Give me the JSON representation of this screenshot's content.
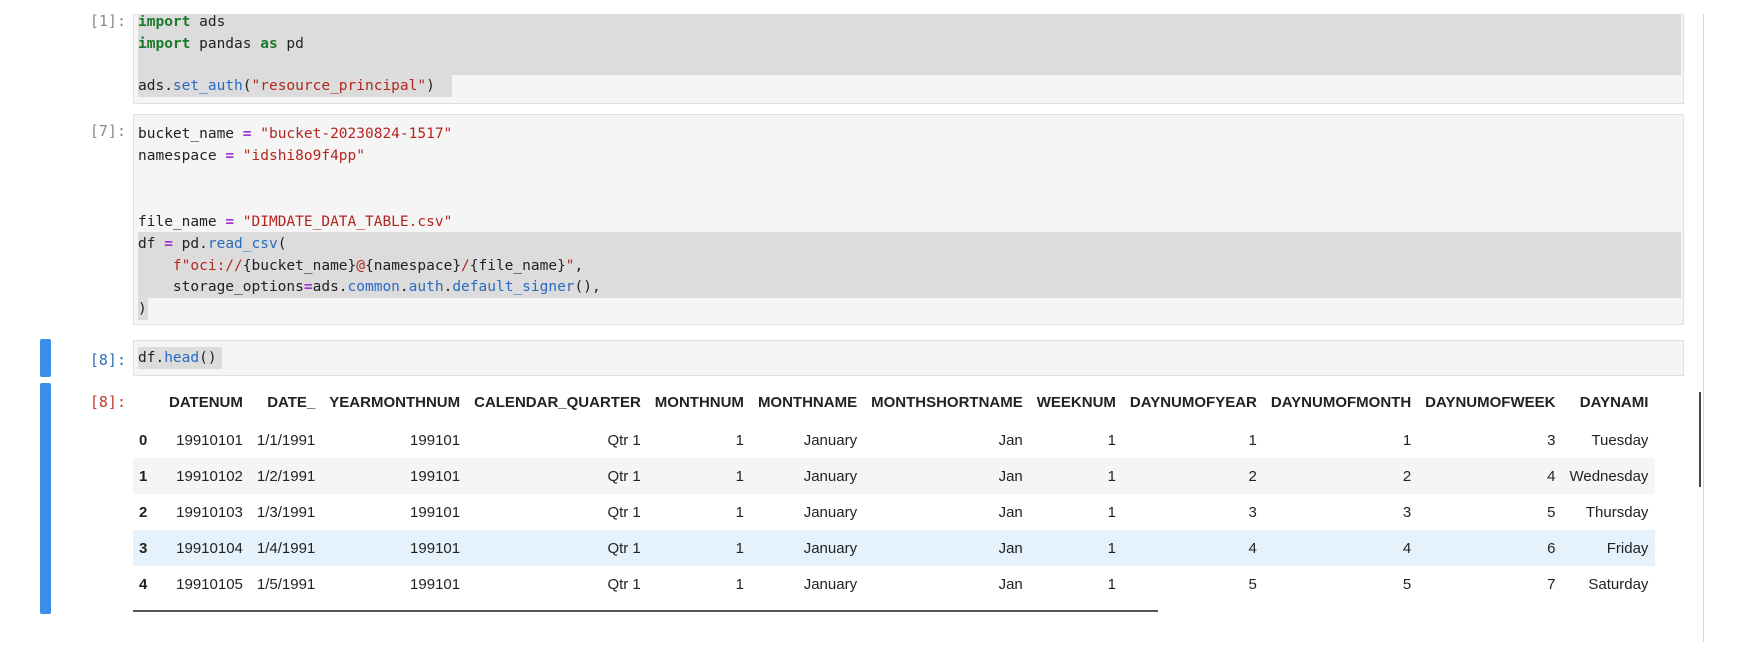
{
  "cells": [
    {
      "prompt": "[1]:",
      "lines": [
        [
          {
            "t": "import",
            "c": "kw"
          },
          {
            "t": " ads",
            "c": "pl"
          }
        ],
        [
          {
            "t": "import",
            "c": "kw"
          },
          {
            "t": " pandas ",
            "c": "pl"
          },
          {
            "t": "as",
            "c": "kw"
          },
          {
            "t": " pd",
            "c": "pl"
          }
        ],
        [],
        [
          {
            "t": "ads.",
            "c": "pl"
          },
          {
            "t": "set_auth",
            "c": "fn"
          },
          {
            "t": "(",
            "c": "pl"
          },
          {
            "t": "\"resource_principal\"",
            "c": "str"
          },
          {
            "t": ")",
            "c": "pl"
          }
        ]
      ]
    },
    {
      "prompt": "[7]:",
      "lines": [
        [
          {
            "t": "bucket_name ",
            "c": "pl"
          },
          {
            "t": "=",
            "c": "op"
          },
          {
            "t": " ",
            "c": "pl"
          },
          {
            "t": "\"bucket-20230824-1517\"",
            "c": "str"
          }
        ],
        [
          {
            "t": "namespace ",
            "c": "pl"
          },
          {
            "t": "=",
            "c": "op"
          },
          {
            "t": " ",
            "c": "pl"
          },
          {
            "t": "\"idshi8o9f4pp\"",
            "c": "str"
          }
        ],
        [],
        [],
        [
          {
            "t": "file_name ",
            "c": "pl"
          },
          {
            "t": "=",
            "c": "op"
          },
          {
            "t": " ",
            "c": "pl"
          },
          {
            "t": "\"DIMDATE_DATA_TABLE.csv\"",
            "c": "str"
          }
        ],
        [
          {
            "t": "df ",
            "c": "pl"
          },
          {
            "t": "=",
            "c": "op"
          },
          {
            "t": " pd.",
            "c": "pl"
          },
          {
            "t": "read_csv",
            "c": "fn"
          },
          {
            "t": "(",
            "c": "pl"
          }
        ],
        [
          {
            "t": "    ",
            "c": "pl"
          },
          {
            "t": "f\"oci://",
            "c": "str"
          },
          {
            "t": "{bucket_name}",
            "c": "pl"
          },
          {
            "t": "@",
            "c": "str"
          },
          {
            "t": "{namespace}",
            "c": "pl"
          },
          {
            "t": "/",
            "c": "str"
          },
          {
            "t": "{file_name}",
            "c": "pl"
          },
          {
            "t": "\"",
            "c": "str"
          },
          {
            "t": ",",
            "c": "pl"
          }
        ],
        [
          {
            "t": "    storage_options",
            "c": "pl"
          },
          {
            "t": "=",
            "c": "op"
          },
          {
            "t": "ads.",
            "c": "pl"
          },
          {
            "t": "common",
            "c": "fn"
          },
          {
            "t": ".",
            "c": "pl"
          },
          {
            "t": "auth",
            "c": "fn"
          },
          {
            "t": ".",
            "c": "pl"
          },
          {
            "t": "default_signer",
            "c": "fn"
          },
          {
            "t": "(),",
            "c": "pl"
          }
        ],
        [
          {
            "t": ")",
            "c": "pl"
          }
        ]
      ]
    },
    {
      "prompt": "[8]:",
      "lines": [
        [
          {
            "t": "df.",
            "c": "pl"
          },
          {
            "t": "head",
            "c": "fn"
          },
          {
            "t": "()",
            "c": "pl"
          }
        ]
      ]
    }
  ],
  "output": {
    "prompt": "[8]:",
    "columns": [
      "",
      "DATENUM",
      "DATE_",
      "YEARMONTHNUM",
      "CALENDAR_QUARTER",
      "MONTHNUM",
      "MONTHNAME",
      "MONTHSHORTNAME",
      "WEEKNUM",
      "DAYNUMOFYEAR",
      "DAYNUMOFMONTH",
      "DAYNUMOFWEEK",
      "DAYNAMI"
    ],
    "rows": [
      [
        "0",
        "19910101",
        "1/1/1991",
        "199101",
        "Qtr 1",
        "1",
        "January",
        "Jan",
        "1",
        "1",
        "1",
        "3",
        "Tuesday"
      ],
      [
        "1",
        "19910102",
        "1/2/1991",
        "199101",
        "Qtr 1",
        "1",
        "January",
        "Jan",
        "1",
        "2",
        "2",
        "4",
        "Wednesday"
      ],
      [
        "2",
        "19910103",
        "1/3/1991",
        "199101",
        "Qtr 1",
        "1",
        "January",
        "Jan",
        "1",
        "3",
        "3",
        "5",
        "Thursday"
      ],
      [
        "3",
        "19910104",
        "1/4/1991",
        "199101",
        "Qtr 1",
        "1",
        "January",
        "Jan",
        "1",
        "4",
        "4",
        "6",
        "Friday"
      ],
      [
        "4",
        "19910105",
        "1/5/1991",
        "199101",
        "Qtr 1",
        "1",
        "January",
        "Jan",
        "1",
        "5",
        "5",
        "7",
        "Saturday"
      ]
    ],
    "hovered_row_index": 3
  },
  "colors": {
    "selection_bar": "#3b8fe8",
    "keyword": "#1a7a2a",
    "operator": "#a22fd6",
    "string": "#b3261e",
    "function": "#2a6bc2",
    "row_hover": "#e6f2fb"
  }
}
